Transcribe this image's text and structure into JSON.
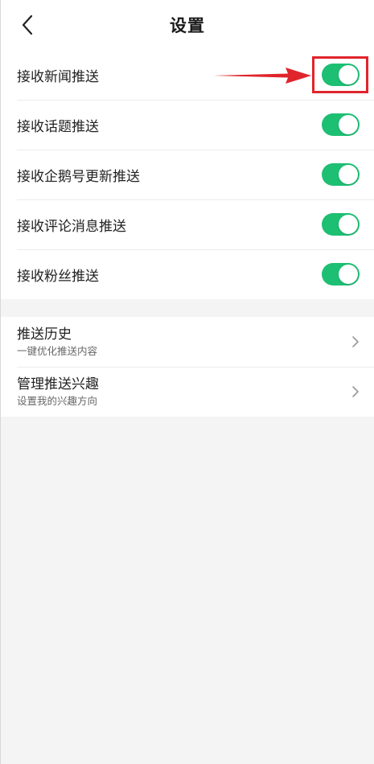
{
  "header": {
    "title": "设置",
    "back_icon": "chevron-left-icon"
  },
  "toggles": [
    {
      "label": "接收新闻推送",
      "on": true
    },
    {
      "label": "接收话题推送",
      "on": true
    },
    {
      "label": "接收企鹅号更新推送",
      "on": true
    },
    {
      "label": "接收评论消息推送",
      "on": true
    },
    {
      "label": "接收粉丝推送",
      "on": true
    }
  ],
  "nav_items": [
    {
      "title": "推送历史",
      "subtitle": "一键优化推送内容"
    },
    {
      "title": "管理推送兴趣",
      "subtitle": "设置我的兴趣方向"
    }
  ],
  "colors": {
    "toggle_on": "#1dbf73",
    "highlight": "#e0242c",
    "background": "#f4f4f4"
  }
}
